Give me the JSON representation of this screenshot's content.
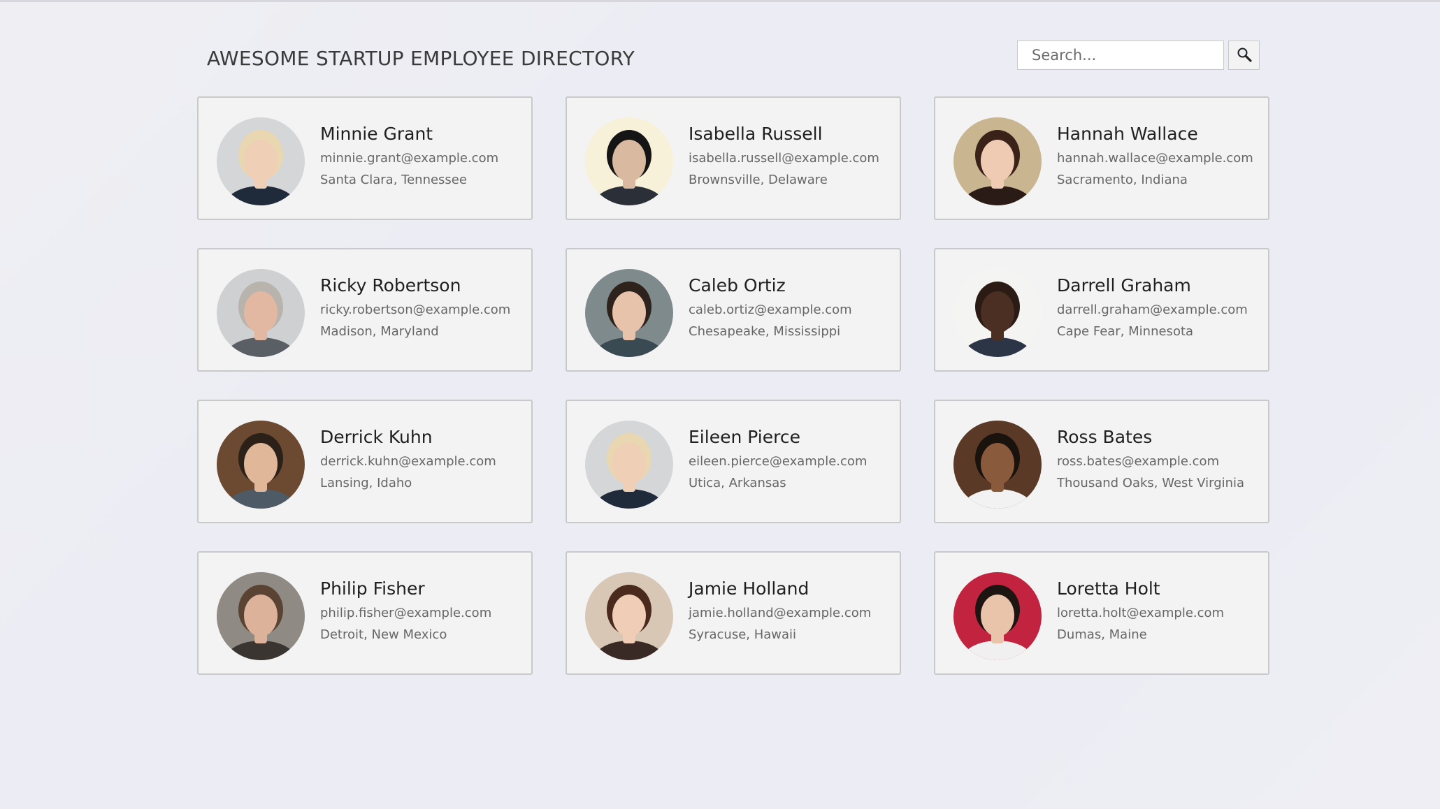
{
  "header": {
    "title": "AWESOME STARTUP EMPLOYEE DIRECTORY",
    "search_placeholder": "Search..."
  },
  "employees": [
    {
      "name": "Minnie Grant",
      "email": "minnie.grant@example.com",
      "location": "Santa Clara, Tennessee",
      "photo": {
        "bg": "#d4d6d8",
        "skin": "#efcfb6",
        "hair": "#e8d7b0",
        "shirt": "#1f2b3a"
      }
    },
    {
      "name": "Isabella Russell",
      "email": "isabella.russell@example.com",
      "location": "Brownsville, Delaware",
      "photo": {
        "bg": "#f6f1d8",
        "skin": "#d9b9a0",
        "hair": "#151515",
        "shirt": "#2b2f38"
      }
    },
    {
      "name": "Hannah Wallace",
      "email": "hannah.wallace@example.com",
      "location": "Sacramento, Indiana",
      "photo": {
        "bg": "#c9b58f",
        "skin": "#efcbb4",
        "hair": "#3a2218",
        "shirt": "#2a1b16"
      }
    },
    {
      "name": "Ricky Robertson",
      "email": "ricky.robertson@example.com",
      "location": "Madison, Maryland",
      "photo": {
        "bg": "#cfd0d1",
        "skin": "#e2b8a2",
        "hair": "#b8b3ad",
        "shirt": "#5a5f66"
      }
    },
    {
      "name": "Caleb Ortiz",
      "email": "caleb.ortiz@example.com",
      "location": "Chesapeake, Mississippi",
      "photo": {
        "bg": "#7f8a8d",
        "skin": "#e6c3aa",
        "hair": "#2e231c",
        "shirt": "#3a4a52"
      }
    },
    {
      "name": "Darrell Graham",
      "email": "darrell.graham@example.com",
      "location": "Cape Fear, Minnesota",
      "photo": {
        "bg": "#f4f4f2",
        "skin": "#4a2f22",
        "hair": "#2a1b14",
        "shirt": "#2c3546"
      }
    },
    {
      "name": "Derrick Kuhn",
      "email": "derrick.kuhn@example.com",
      "location": "Lansing, Idaho",
      "photo": {
        "bg": "#6b4a31",
        "skin": "#e1b79a",
        "hair": "#2b2119",
        "shirt": "#4e5a66"
      }
    },
    {
      "name": "Eileen Pierce",
      "email": "eileen.pierce@example.com",
      "location": "Utica, Arkansas",
      "photo": {
        "bg": "#d4d6d8",
        "skin": "#efcfb6",
        "hair": "#e8d7b0",
        "shirt": "#1f2b3a"
      }
    },
    {
      "name": "Ross Bates",
      "email": "ross.bates@example.com",
      "location": "Thousand Oaks, West Virginia",
      "photo": {
        "bg": "#5a3a26",
        "skin": "#8a5a3c",
        "hair": "#1a120d",
        "shirt": "#f2f2f2"
      }
    },
    {
      "name": "Philip Fisher",
      "email": "philip.fisher@example.com",
      "location": "Detroit, New Mexico",
      "photo": {
        "bg": "#8f8a84",
        "skin": "#dcb39a",
        "hair": "#5a4332",
        "shirt": "#3b3531"
      }
    },
    {
      "name": "Jamie Holland",
      "email": "jamie.holland@example.com",
      "location": "Syracuse, Hawaii",
      "photo": {
        "bg": "#d9c7b5",
        "skin": "#f0cdb7",
        "hair": "#4a2a1d",
        "shirt": "#3a2a26"
      }
    },
    {
      "name": "Loretta Holt",
      "email": "loretta.holt@example.com",
      "location": "Dumas, Maine",
      "photo": {
        "bg": "#c2243f",
        "skin": "#e9c4aa",
        "hair": "#1c1512",
        "shirt": "#f0f0f0"
      }
    }
  ]
}
